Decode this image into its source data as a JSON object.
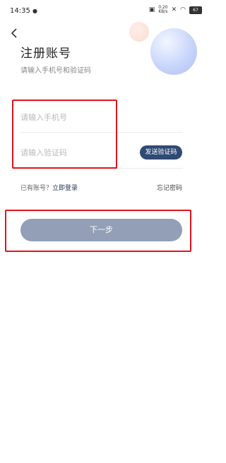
{
  "status_bar": {
    "time": "14:35",
    "wechat_icon": "wechat-icon",
    "speed_top": "0.20",
    "speed_bottom": "KB/s",
    "battery": "67"
  },
  "header": {
    "back_icon": "chevron-left-icon",
    "title": "注册账号",
    "subtitle": "请输入手机号和验证码"
  },
  "form": {
    "phone_placeholder": "请输入手机号",
    "code_placeholder": "请输入验证码",
    "send_code_label": "发送验证码"
  },
  "links": {
    "have_account": "已有账号？",
    "login": "立即登录",
    "forgot_password": "忘记密码"
  },
  "actions": {
    "next_label": "下一步"
  },
  "colors": {
    "highlight": "#e0141e",
    "send_button": "#2f4a74",
    "next_button": "#929fb7"
  }
}
